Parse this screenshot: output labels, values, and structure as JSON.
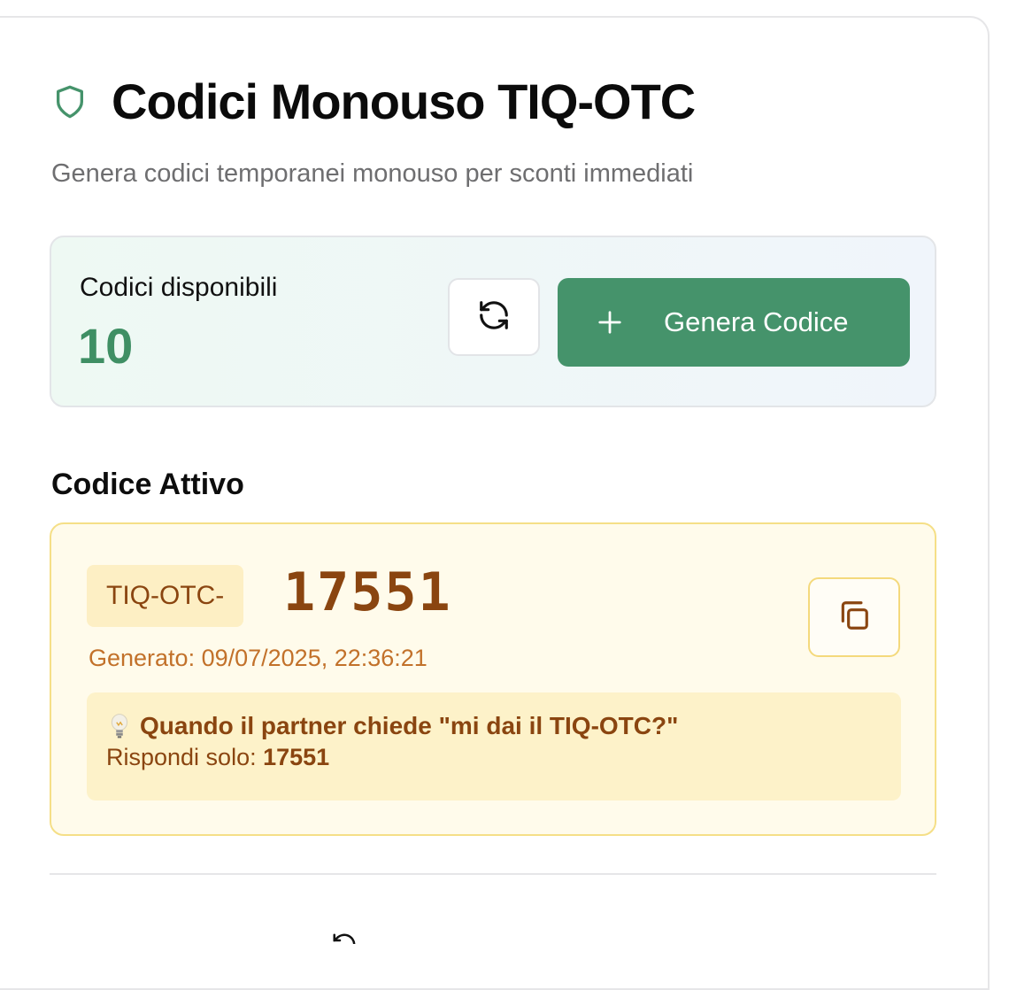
{
  "header": {
    "title": "Codici Monouso TIQ-OTC",
    "subtitle": "Genera codici temporanei monouso per sconti immediati",
    "icon": "shield-icon"
  },
  "stats": {
    "label": "Codici disponibili",
    "value": "10",
    "refresh_icon": "refresh-icon",
    "generate_label": "Genera Codice",
    "generate_icon": "plus-icon"
  },
  "active_code": {
    "section_title": "Codice Attivo",
    "prefix": "TIQ-OTC-",
    "number": "17551",
    "generated": "Generato: 09/07/2025, 22:36:21",
    "copy_icon": "copy-icon",
    "hint_question": "Quando il partner chiede \"mi dai il TIQ-OTC?\"",
    "hint_answer_label": "Rispondi solo: ",
    "hint_answer_value": "17551"
  },
  "colors": {
    "accent_green": "#45936b",
    "value_green": "#3f8f64",
    "code_brown": "#8a4510",
    "generated_orange": "#c2712a",
    "code_bg": "#fffbeb",
    "hint_bg": "#fdf2c9"
  }
}
